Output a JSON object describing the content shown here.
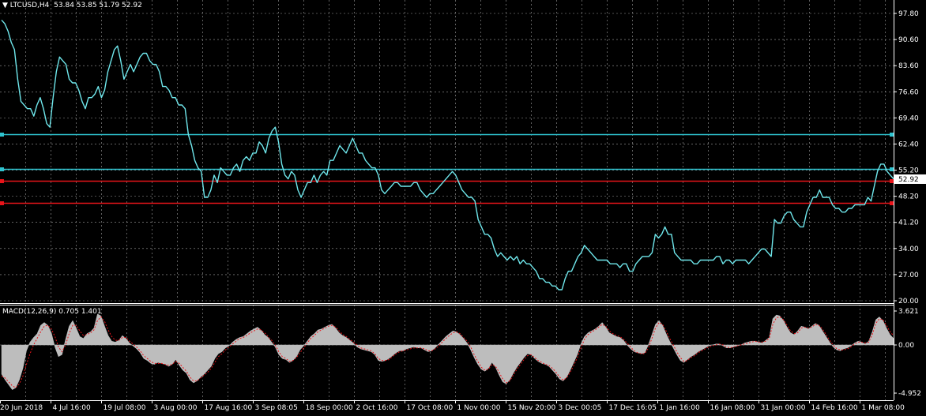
{
  "header": {
    "symbol": "LTCUSD,H4",
    "ohlc": "53.84 53.85 51.79 52.92",
    "dropdown_icon": "triangle-down-icon"
  },
  "macd_header": {
    "label": "MACD(12,26,9) 0.705 1.401"
  },
  "colors": {
    "background": "#000000",
    "grid": "#a0a0a0",
    "price_line": "#6fe7ec",
    "horizontal_cyan": "#2fc3cf",
    "horizontal_red": "#e8141a",
    "macd_histogram": "#bdbdbd",
    "macd_signal": "#e8141a",
    "axis_text": "#ffffff"
  },
  "chart_data": [
    {
      "type": "line",
      "title": "LTCUSD,H4",
      "ylim": [
        20.0,
        97.8
      ],
      "price_axis_ticks": [
        "97.80",
        "90.60",
        "83.60",
        "76.60",
        "69.40",
        "62.40",
        "55.20",
        "48.20",
        "41.20",
        "34.00",
        "27.00",
        "20.00"
      ],
      "current_price_label": "52.92",
      "time_axis_ticks": [
        "20 Jun 2018",
        "4 Jul 16:00",
        "19 Jul 08:00",
        "3 Aug 00:00",
        "17 Aug 16:00",
        "3 Sep 08:05",
        "18 Sep 00:00",
        "2 Oct 16:00",
        "17 Oct 08:00",
        "1 Nov 00:00",
        "15 Nov 20:00",
        "3 Dec 00:05",
        "17 Dec 16:05",
        "1 Jan 16:00",
        "16 Jan 08:00",
        "31 Jan 00:00",
        "14 Feb 16:00",
        "1 Mar 08:00"
      ],
      "horizontal_levels": [
        {
          "price": 65.0,
          "color": "cyan"
        },
        {
          "price": 55.7,
          "color": "cyan"
        },
        {
          "price": 52.4,
          "color": "red"
        },
        {
          "price": 46.5,
          "color": "red"
        }
      ],
      "series": [
        {
          "values": [
            96,
            95,
            93,
            90,
            88,
            80,
            74,
            73,
            72,
            72,
            70,
            73,
            75,
            72,
            68,
            67,
            75,
            82,
            86,
            85,
            84,
            80,
            79,
            79,
            77,
            74,
            72,
            75,
            75,
            76,
            78,
            75,
            77,
            82,
            85,
            88,
            89,
            85,
            80,
            82,
            84,
            82,
            84,
            86,
            87,
            87,
            85,
            84,
            84,
            82,
            78,
            78,
            77,
            75,
            75,
            73,
            73,
            72,
            65,
            62,
            58,
            56,
            55,
            48,
            48,
            50,
            54,
            52,
            56,
            55,
            54,
            54,
            56,
            57,
            55,
            58,
            59,
            58,
            60,
            60,
            63,
            62,
            60,
            64,
            66,
            67,
            63,
            57,
            54,
            53,
            55,
            54,
            50,
            48,
            50,
            52,
            52,
            54,
            52,
            54,
            55,
            54,
            58,
            58,
            60,
            62,
            61,
            60,
            62,
            64,
            62,
            60,
            60,
            58,
            57,
            56,
            56,
            54,
            50,
            49,
            50,
            51,
            52,
            52,
            51,
            51,
            51,
            51,
            52,
            52,
            50,
            49,
            48,
            49,
            49,
            50,
            51,
            52,
            53,
            54,
            55,
            54,
            52,
            50,
            49,
            48,
            48,
            47,
            42,
            40,
            38,
            38,
            37,
            34,
            32,
            33,
            32,
            31,
            32,
            31,
            32,
            30,
            31,
            30,
            30,
            29,
            28,
            26,
            26,
            25,
            25,
            24,
            24,
            23,
            23,
            26,
            28,
            28,
            30,
            32,
            33,
            35,
            34,
            33,
            32,
            31,
            31,
            31,
            31,
            30,
            30,
            30,
            29,
            30,
            30,
            28,
            28,
            30,
            31,
            32,
            32,
            32,
            33,
            38,
            37,
            38,
            40,
            38,
            38,
            33,
            32,
            31,
            31,
            31,
            31,
            30,
            30,
            31,
            31,
            31,
            31,
            31,
            32,
            32,
            30,
            31,
            31,
            30,
            31,
            31,
            31,
            31,
            30,
            31,
            32,
            33,
            34,
            34,
            33,
            32,
            42,
            41,
            41,
            43,
            44,
            44,
            42,
            41,
            40,
            40,
            44,
            46,
            48,
            48,
            50,
            48,
            48,
            48,
            46,
            45,
            45,
            44,
            44,
            45,
            45,
            46,
            46,
            46,
            46,
            48,
            47,
            51,
            55,
            57,
            57,
            55,
            54,
            53
          ]
        }
      ]
    },
    {
      "type": "bar",
      "title": "MACD(12,26,9)",
      "ylim": [
        -4.952,
        3.621
      ],
      "axis_ticks": [
        "3.621",
        "0.00",
        "-4.952"
      ],
      "series": [
        {
          "name": "MACD",
          "values": [
            -3.0,
            -3.6,
            -4.1,
            -4.6,
            -4.4,
            -3.6,
            -2.4,
            -0.6,
            0.3,
            0.8,
            1.2,
            2.1,
            2.4,
            2.1,
            1.3,
            -0.2,
            -1.2,
            -1.0,
            0.6,
            2.0,
            2.6,
            1.8,
            0.9,
            0.7,
            1.2,
            1.4,
            1.8,
            3.3,
            3.1,
            2.0,
            1.0,
            0.4,
            0.3,
            0.5,
            1.0,
            0.7,
            0.2,
            -0.1,
            -0.4,
            -0.8,
            -1.4,
            -1.6,
            -1.9,
            -2.0,
            -1.8,
            -1.9,
            -2.0,
            -2.2,
            -2.0,
            -1.5,
            -2.1,
            -2.6,
            -2.9,
            -3.6,
            -3.9,
            -3.7,
            -3.3,
            -3.0,
            -2.6,
            -2.2,
            -1.4,
            -0.9,
            -0.7,
            -0.3,
            -0.1,
            0.3,
            0.6,
            0.8,
            0.9,
            1.2,
            1.5,
            1.7,
            1.9,
            1.6,
            1.1,
            0.8,
            0.3,
            -0.2,
            -1.0,
            -1.4,
            -1.5,
            -1.8,
            -1.6,
            -1.2,
            -0.5,
            -0.1,
            0.4,
            0.9,
            1.2,
            1.6,
            1.7,
            1.9,
            2.1,
            2.2,
            1.8,
            1.3,
            1.0,
            0.8,
            0.5,
            0.2,
            -0.2,
            -0.4,
            -0.5,
            -0.6,
            -0.7,
            -1.0,
            -1.6,
            -1.7,
            -1.6,
            -1.4,
            -1.1,
            -0.8,
            -0.6,
            -0.6,
            -0.4,
            -0.3,
            -0.2,
            -0.3,
            -0.3,
            -0.5,
            -0.7,
            -0.6,
            -0.3,
            0.1,
            0.5,
            0.9,
            1.2,
            1.5,
            1.4,
            1.1,
            0.7,
            0.2,
            -0.5,
            -1.3,
            -2.0,
            -2.5,
            -2.7,
            -2.4,
            -1.8,
            -2.3,
            -3.1,
            -3.8,
            -4.0,
            -3.6,
            -2.9,
            -2.3,
            -1.8,
            -1.3,
            -0.9,
            -1.0,
            -1.4,
            -1.7,
            -1.9,
            -2.0,
            -2.2,
            -2.6,
            -3.0,
            -3.5,
            -3.7,
            -3.3,
            -2.6,
            -1.8,
            -1.0,
            0.1,
            0.9,
            1.3,
            1.5,
            1.7,
            2.0,
            2.4,
            1.9,
            1.3,
            1.1,
            0.9,
            0.8,
            0.5,
            0.0,
            -0.4,
            -0.7,
            -0.8,
            -0.9,
            -0.8,
            0.0,
            1.1,
            2.2,
            2.6,
            2.1,
            1.2,
            0.4,
            -0.3,
            -1.0,
            -1.6,
            -1.8,
            -1.5,
            -1.2,
            -1.0,
            -0.7,
            -0.5,
            -0.3,
            -0.1,
            0.0,
            0.1,
            0.1,
            -0.1,
            -0.3,
            -0.3,
            -0.2,
            -0.1,
            0.0,
            0.2,
            0.3,
            0.4,
            0.4,
            0.3,
            0.2,
            0.5,
            0.8,
            2.8,
            3.2,
            3.1,
            2.6,
            1.9,
            1.3,
            1.1,
            1.5,
            2.0,
            1.9,
            1.7,
            2.0,
            2.3,
            2.1,
            1.5,
            0.9,
            0.3,
            -0.2,
            -0.5,
            -0.6,
            -0.4,
            -0.3,
            -0.1,
            0.2,
            0.4,
            0.3,
            0.1,
            0.4,
            1.4,
            2.7,
            3.0,
            2.6,
            1.8,
            1.1,
            0.7
          ]
        },
        {
          "name": "Signal",
          "values": [
            -3.2,
            -3.4,
            -3.8,
            -4.2,
            -4.4,
            -4.0,
            -3.2,
            -2.0,
            -0.9,
            0.0,
            0.7,
            1.4,
            2.0,
            2.1,
            1.7,
            0.9,
            -0.2,
            -0.7,
            0.0,
            1.2,
            2.1,
            2.1,
            1.5,
            1.0,
            1.1,
            1.3,
            1.6,
            2.6,
            3.0,
            2.5,
            1.6,
            0.9,
            0.5,
            0.5,
            0.8,
            0.8,
            0.4,
            0.1,
            -0.2,
            -0.6,
            -1.1,
            -1.4,
            -1.7,
            -1.9,
            -1.9,
            -1.9,
            -2.0,
            -2.1,
            -2.0,
            -1.7,
            -1.9,
            -2.3,
            -2.7,
            -3.3,
            -3.7,
            -3.7,
            -3.4,
            -3.1,
            -2.8,
            -2.4,
            -1.8,
            -1.2,
            -0.9,
            -0.5,
            -0.2,
            0.1,
            0.4,
            0.7,
            0.8,
            1.0,
            1.3,
            1.5,
            1.7,
            1.6,
            1.3,
            0.9,
            0.5,
            0.0,
            -0.7,
            -1.2,
            -1.4,
            -1.7,
            -1.6,
            -1.3,
            -0.8,
            -0.3,
            0.2,
            0.7,
            1.0,
            1.4,
            1.6,
            1.8,
            2.0,
            2.1,
            1.9,
            1.5,
            1.1,
            0.9,
            0.6,
            0.3,
            0.0,
            -0.3,
            -0.4,
            -0.5,
            -0.6,
            -0.9,
            -1.4,
            -1.6,
            -1.6,
            -1.5,
            -1.2,
            -0.9,
            -0.7,
            -0.6,
            -0.5,
            -0.4,
            -0.3,
            -0.3,
            -0.3,
            -0.4,
            -0.6,
            -0.6,
            -0.4,
            -0.1,
            0.3,
            0.7,
            1.0,
            1.3,
            1.4,
            1.2,
            0.8,
            0.4,
            -0.2,
            -1.0,
            -1.7,
            -2.3,
            -2.6,
            -2.5,
            -2.0,
            -2.2,
            -2.8,
            -3.5,
            -3.9,
            -3.7,
            -3.1,
            -2.5,
            -2.0,
            -1.5,
            -1.1,
            -1.0,
            -1.3,
            -1.6,
            -1.8,
            -2.0,
            -2.1,
            -2.4,
            -2.8,
            -3.3,
            -3.6,
            -3.4,
            -2.8,
            -2.1,
            -1.3,
            -0.3,
            0.6,
            1.1,
            1.4,
            1.6,
            1.9,
            2.2,
            2.0,
            1.5,
            1.2,
            1.0,
            0.9,
            0.6,
            0.2,
            -0.2,
            -0.6,
            -0.8,
            -0.9,
            -0.9,
            -0.3,
            0.7,
            1.8,
            2.4,
            2.2,
            1.5,
            0.7,
            0.0,
            -0.7,
            -1.3,
            -1.7,
            -1.6,
            -1.3,
            -1.1,
            -0.8,
            -0.6,
            -0.4,
            -0.2,
            -0.1,
            0.0,
            0.1,
            0.0,
            -0.2,
            -0.3,
            -0.2,
            -0.1,
            0.0,
            0.1,
            0.2,
            0.3,
            0.4,
            0.3,
            0.3,
            0.4,
            0.7,
            2.2,
            2.9,
            3.0,
            2.7,
            2.1,
            1.5,
            1.2,
            1.3,
            1.8,
            1.9,
            1.8,
            1.9,
            2.2,
            2.1,
            1.7,
            1.1,
            0.5,
            0.0,
            -0.4,
            -0.5,
            -0.5,
            -0.4,
            -0.2,
            0.1,
            0.3,
            0.3,
            0.2,
            0.3,
            1.1,
            2.3,
            2.8,
            2.7,
            2.1,
            1.4,
            1.0
          ]
        }
      ]
    }
  ]
}
